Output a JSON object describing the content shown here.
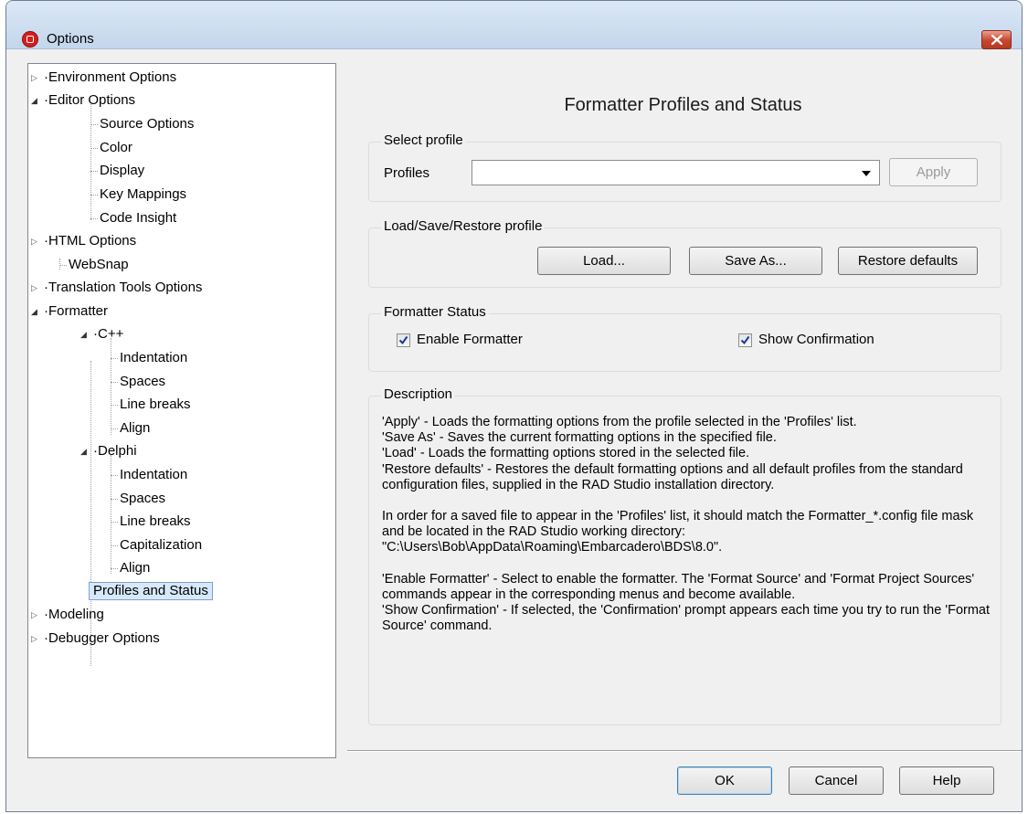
{
  "window": {
    "title": "Options"
  },
  "tree": {
    "environment_options": "Environment Options",
    "editor_options": "Editor Options",
    "source_options": "Source Options",
    "color": "Color",
    "display": "Display",
    "key_mappings": "Key Mappings",
    "code_insight": "Code Insight",
    "html_options": "HTML Options",
    "websnap": "WebSnap",
    "translation_tools_options": "Translation Tools Options",
    "formatter": "Formatter",
    "cpp": "C++",
    "cpp_indentation": "Indentation",
    "cpp_spaces": "Spaces",
    "cpp_line_breaks": "Line breaks",
    "cpp_align": "Align",
    "delphi": "Delphi",
    "delphi_indentation": "Indentation",
    "delphi_spaces": "Spaces",
    "delphi_line_breaks": "Line breaks",
    "delphi_capitalization": "Capitalization",
    "delphi_align": "Align",
    "profiles_and_status": "Profiles and Status",
    "modeling": "Modeling",
    "debugger_options": "Debugger Options"
  },
  "panel": {
    "title": "Formatter Profiles and Status",
    "select_profile": {
      "legend": "Select profile",
      "profiles_label": "Profiles",
      "profiles_value": "",
      "apply_label": "Apply"
    },
    "load_save": {
      "legend": "Load/Save/Restore profile",
      "load_label": "Load...",
      "save_as_label": "Save As...",
      "restore_label": "Restore defaults"
    },
    "status": {
      "legend": "Formatter Status",
      "enable_formatter_label": "Enable Formatter",
      "enable_formatter_checked": true,
      "show_confirmation_label": "Show Confirmation",
      "show_confirmation_checked": true
    },
    "description": {
      "legend": "Description",
      "line1": "'Apply' - Loads the formatting options from the profile selected in the 'Profiles' list.",
      "line2": "'Save As' - Saves the current formatting options in the specified file.",
      "line3": "'Load' - Loads the formatting options stored in the selected file.",
      "line4": "'Restore defaults' - Restores the default formatting options and all default profiles from the standard configuration files, supplied in the RAD Studio installation directory.",
      "line5": "In order for a saved file to appear in the 'Profiles' list, it should match the Formatter_*.config file mask and be located in the RAD Studio working directory: \"C:\\Users\\Bob\\AppData\\Roaming\\Embarcadero\\BDS\\8.0\".",
      "line6": "'Enable Formatter' - Select to enable the formatter. The 'Format Source' and 'Format Project Sources' commands appear in the corresponding menus and become available.",
      "line7": "'Show Confirmation' - If selected, the 'Confirmation' prompt appears each time you try to run the 'Format Source' command."
    }
  },
  "buttons": {
    "ok": "OK",
    "cancel": "Cancel",
    "help": "Help"
  }
}
